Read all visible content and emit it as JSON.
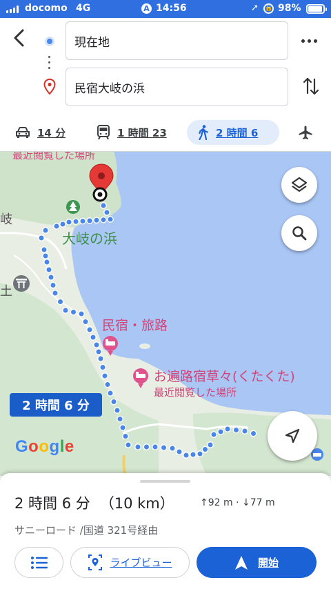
{
  "status_bar": {
    "carrier": "docomo",
    "network": "4G",
    "time": "14:56",
    "battery": "98%",
    "battery_level": 0.98
  },
  "route": {
    "origin": "現在地",
    "destination": "民宿大岐の浜"
  },
  "modes": [
    {
      "name": "car-icon",
      "label": "14 分"
    },
    {
      "name": "train-icon",
      "label": "1 時間 23"
    },
    {
      "name": "walk-icon",
      "label": "2 時間 6",
      "selected": true
    },
    {
      "name": "plane-icon",
      "label": ""
    }
  ],
  "map": {
    "labels": {
      "recent_top": "最近閲覧した場所",
      "oki_beach": "大岐の浜",
      "minshuku": "民宿・旅路",
      "ohenro": "お遍路宿草々(くたくた)",
      "recent2": "最近閲覧した場所",
      "edge1": "岐",
      "edge2": "土"
    },
    "duration_chip": "2 時間 6 分",
    "logo": "Google",
    "colors": {
      "water": "#a9c6f5",
      "land": "#e8eee4",
      "route": "#4a86e8",
      "pin": "#e53935"
    }
  },
  "sheet": {
    "duration": "2 時間 6 分",
    "distance": "（10 km）",
    "elevation": "↑92 m · ↓77 m",
    "via": "サニーロード /国道 321号経由",
    "live_view": "ライブビュー",
    "start": "開始"
  }
}
